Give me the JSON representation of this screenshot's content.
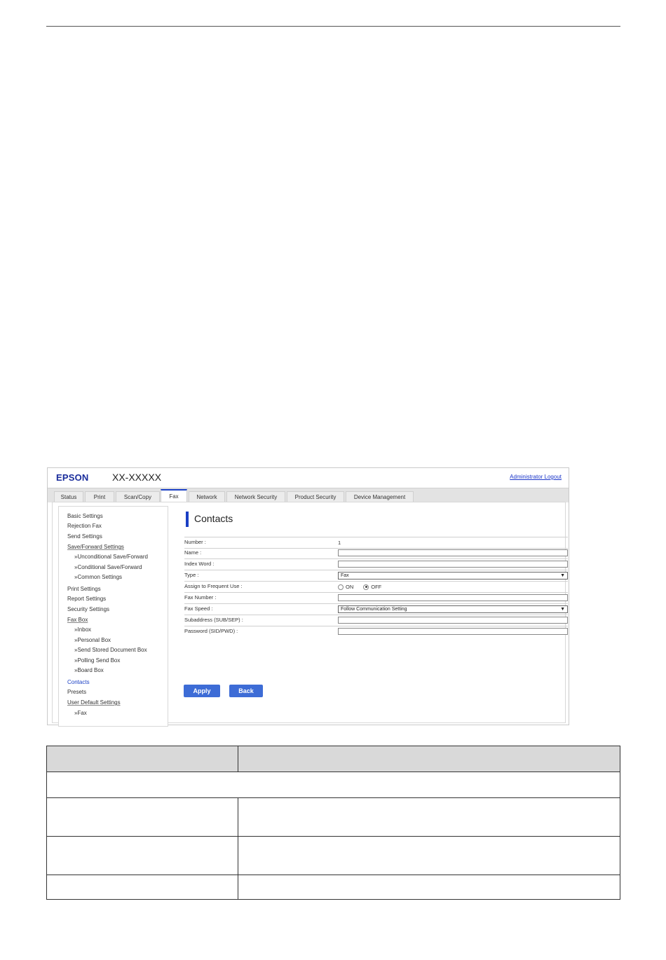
{
  "header": {
    "logo": "EPSON",
    "model": "XX-XXXXX",
    "logout_link": "Administrator Logout"
  },
  "tabs": [
    {
      "label": "Status"
    },
    {
      "label": "Print"
    },
    {
      "label": "Scan/Copy"
    },
    {
      "label": "Fax",
      "active": true
    },
    {
      "label": "Network"
    },
    {
      "label": "Network Security"
    },
    {
      "label": "Product Security"
    },
    {
      "label": "Device Management"
    }
  ],
  "sidebar": {
    "items": [
      {
        "label": "Basic Settings"
      },
      {
        "label": "Rejection Fax"
      },
      {
        "label": "Send Settings"
      },
      {
        "label": "Save/Forward Settings"
      },
      {
        "label": "»Unconditional Save/Forward"
      },
      {
        "label": "»Conditional Save/Forward"
      },
      {
        "label": "»Common Settings"
      },
      {
        "label": "Print Settings"
      },
      {
        "label": "Report Settings"
      },
      {
        "label": "Security Settings"
      },
      {
        "label": "Fax Box"
      },
      {
        "label": "»Inbox"
      },
      {
        "label": "»Personal Box"
      },
      {
        "label": "»Send Stored Document Box"
      },
      {
        "label": "»Polling Send Box"
      },
      {
        "label": "»Board Box"
      },
      {
        "label": "Contacts"
      },
      {
        "label": "Presets"
      },
      {
        "label": "User Default Settings"
      },
      {
        "label": "»Fax"
      }
    ]
  },
  "main": {
    "title": "Contacts",
    "form": {
      "number_label": "Number :",
      "number_value": "1",
      "name_label": "Name :",
      "name_value": "",
      "index_word_label": "Index Word :",
      "index_word_value": "",
      "type_label": "Type :",
      "type_value": "Fax",
      "frequent_label": "Assign to Frequent Use :",
      "frequent_on": "ON",
      "frequent_off": "OFF",
      "frequent_selected": "OFF",
      "fax_number_label": "Fax Number :",
      "fax_number_value": "",
      "fax_speed_label": "Fax Speed :",
      "fax_speed_value": "Follow Communication Setting",
      "subaddress_label": "Subaddress (SUB/SEP) :",
      "subaddress_value": "",
      "password_label": "Password (SID/PWD) :",
      "password_value": ""
    },
    "buttons": {
      "apply": "Apply",
      "back": "Back"
    }
  },
  "arrow_glyph": "▼"
}
